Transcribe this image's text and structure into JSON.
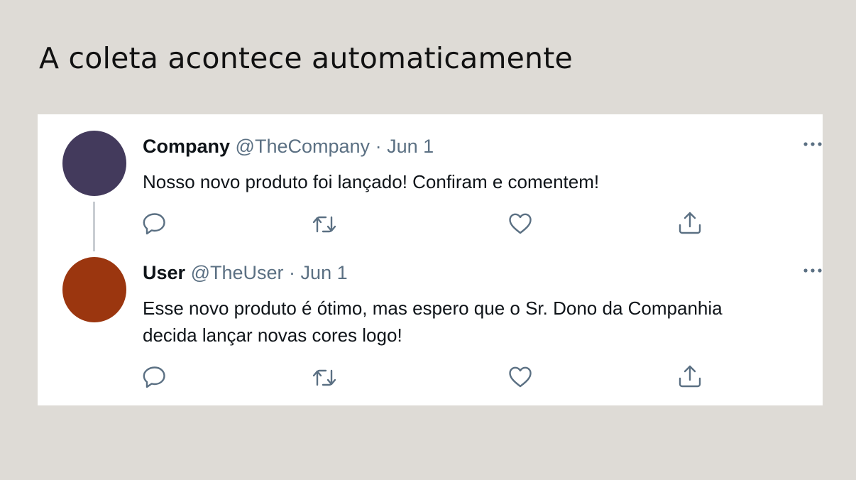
{
  "slide": {
    "title": "A coleta acontece automaticamente"
  },
  "colors": {
    "background": "#dedbd6",
    "card": "#ffffff",
    "icon": "#5b7083",
    "company_avatar": "#433a5c",
    "user_avatar": "#9b360f"
  },
  "tweets": [
    {
      "author": "Company",
      "handle": "@TheCompany",
      "separator": "·",
      "date": "Jun 1",
      "text": "Nosso novo produto foi lançado! Confiram e comentem!",
      "actions": [
        "reply-icon",
        "retweet-icon",
        "like-icon",
        "share-icon"
      ],
      "more_icon": "more-options-icon"
    },
    {
      "author": "User",
      "handle": "@TheUser",
      "separator": "·",
      "date": "Jun 1",
      "text": "Esse novo produto é ótimo, mas espero que o Sr. Dono da Companhia\ndecida lançar novas cores logo!",
      "actions": [
        "reply-icon",
        "retweet-icon",
        "like-icon",
        "share-icon"
      ],
      "more_icon": "more-options-icon"
    }
  ]
}
